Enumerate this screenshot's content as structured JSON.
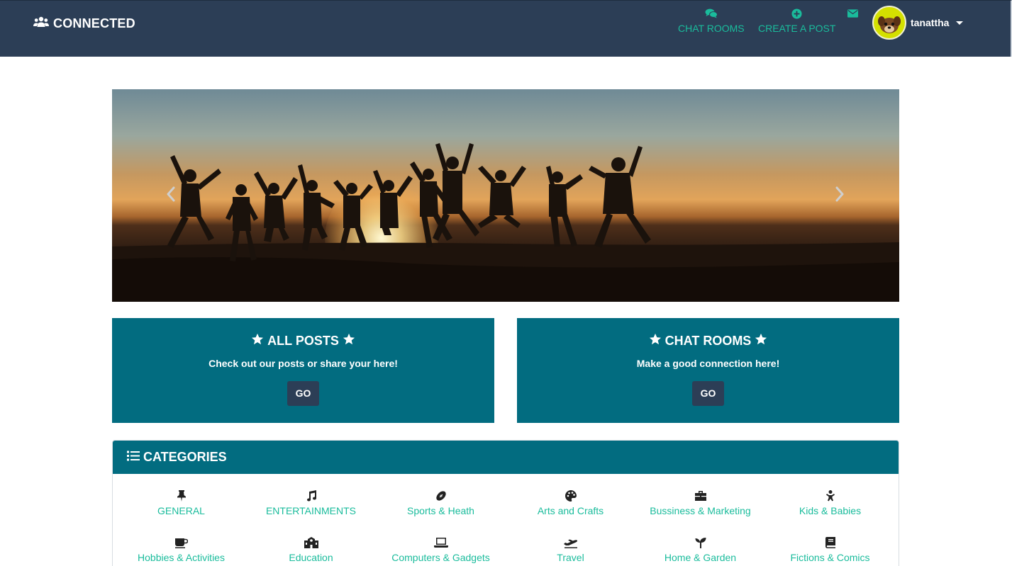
{
  "navbar": {
    "brand": "CONNECTED",
    "brand_icon": "users-icon",
    "links": {
      "chat_rooms": "CHAT ROOMS",
      "create_post": "CREATE A POST"
    },
    "user": {
      "name": "tanattha"
    }
  },
  "colors": {
    "navbar": "#2c3e56",
    "accent": "#1abc9c",
    "panel": "#026c80",
    "button": "#2c3e56"
  },
  "promos": {
    "posts": {
      "title": "ALL POSTS",
      "subtitle": "Check out our posts or share your here!",
      "button": "GO"
    },
    "chat": {
      "title": "CHAT ROOMS",
      "subtitle": "Make a good connection here!",
      "button": "GO"
    }
  },
  "categories": {
    "title": "CATEGORIES",
    "items": [
      {
        "label": "GENERAL",
        "icon": "thumbtack-icon"
      },
      {
        "label": "ENTERTAINMENTS",
        "icon": "music-icon"
      },
      {
        "label": "Sports & Heath",
        "icon": "football-icon"
      },
      {
        "label": "Arts and Crafts",
        "icon": "palette-icon"
      },
      {
        "label": "Bussiness & Marketing",
        "icon": "briefcase-icon"
      },
      {
        "label": "Kids & Babies",
        "icon": "child-icon"
      },
      {
        "label": "Hobbies & Activities",
        "icon": "mug-icon"
      },
      {
        "label": "Education",
        "icon": "school-icon"
      },
      {
        "label": "Computers & Gadgets",
        "icon": "laptop-icon"
      },
      {
        "label": "Travel",
        "icon": "plane-icon"
      },
      {
        "label": "Home & Garden",
        "icon": "seedling-icon"
      },
      {
        "label": "Fictions & Comics",
        "icon": "book-icon"
      }
    ]
  }
}
